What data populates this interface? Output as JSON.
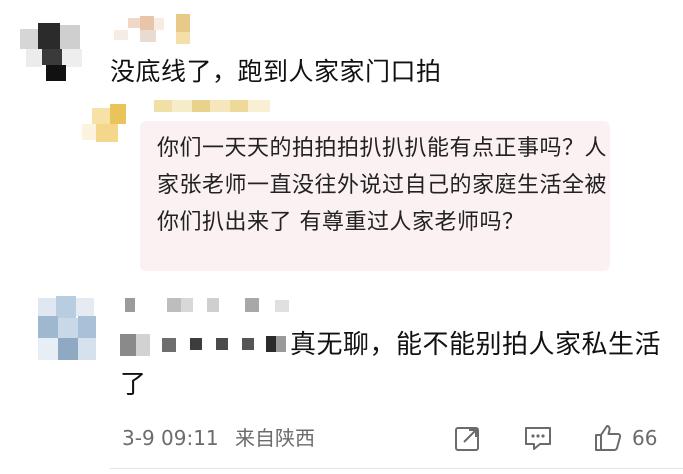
{
  "comments": [
    {
      "text": "没底线了，跑到人家家门口拍",
      "reply": {
        "text": "你们一天天的拍拍拍扒扒扒能有点正事吗？人家张老师一直没往外说过自己的家庭生活全被你们扒出来了 有尊重过人家老师吗？"
      }
    },
    {
      "text": "真无聊，能不能别拍人家私生活了",
      "meta": {
        "date": "3-9 09:11",
        "location": "来自陕西"
      },
      "actions": {
        "like_count": "66"
      }
    }
  ],
  "icons": {
    "share": "share-icon",
    "comment": "comment-icon",
    "like": "thumbs-up-icon"
  },
  "colors": {
    "reply_bg": "#fbf1f3",
    "meta_text": "#6b6b6b"
  }
}
